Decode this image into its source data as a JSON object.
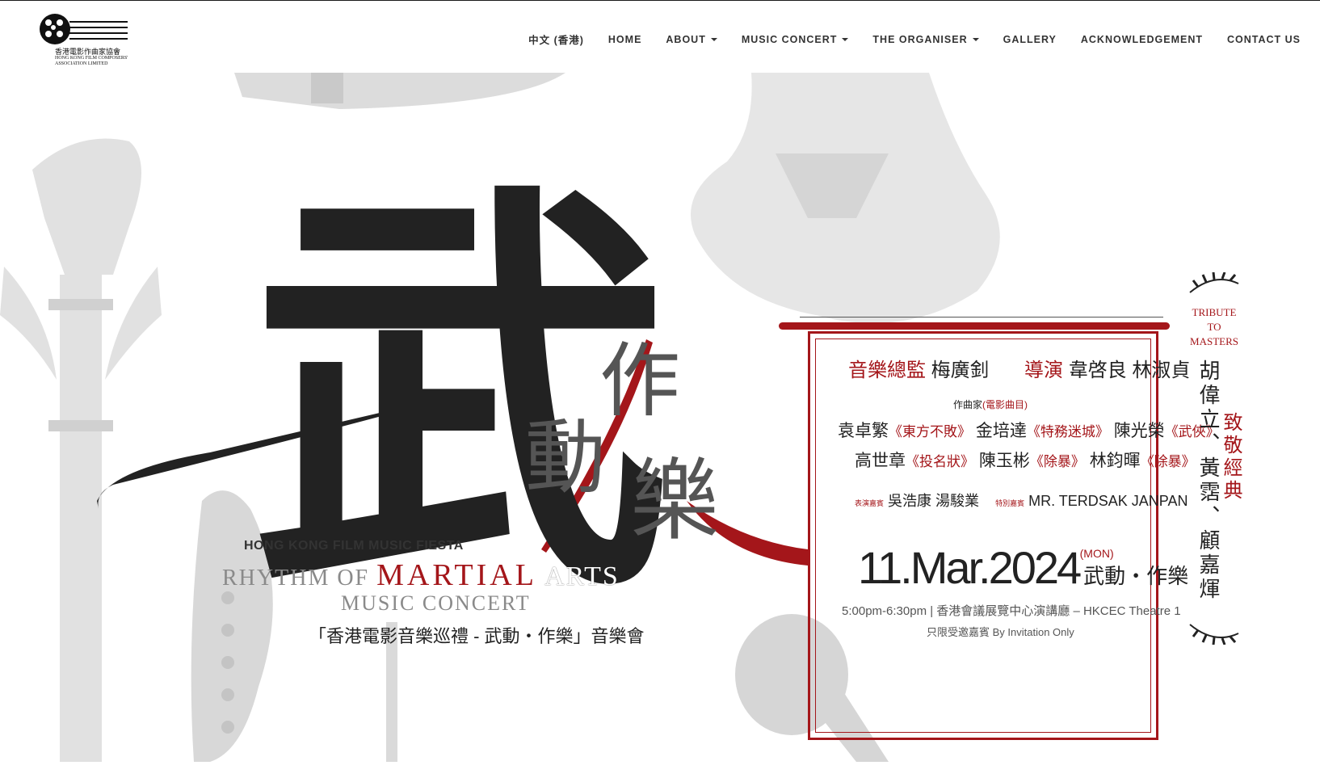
{
  "logo": {
    "cn": "香港電影作曲家協會",
    "en_line1": "HONG KONG FILM COMPOSERS'",
    "en_line2": "ASSOCIATION LIMITED"
  },
  "nav": {
    "items": [
      {
        "label": "中文 (香港)",
        "dropdown": false
      },
      {
        "label": "HOME",
        "dropdown": false
      },
      {
        "label": "ABOUT",
        "dropdown": true
      },
      {
        "label": "MUSIC CONCERT",
        "dropdown": true
      },
      {
        "label": "THE ORGANISER",
        "dropdown": true
      },
      {
        "label": "GALLERY",
        "dropdown": false
      },
      {
        "label": "ACKNOWLEDGEMENT",
        "dropdown": false
      },
      {
        "label": "CONTACT US",
        "dropdown": false
      }
    ]
  },
  "hero": {
    "calligraphy_main": "武",
    "calligraphy_dong": "動",
    "calligraphy_zuo": "作",
    "calligraphy_le": "樂",
    "fiesta": "HONG KONG FILM MUSIC FIESTA",
    "rhythm_of": "RHYTHM OF",
    "martial": "MARTIAL",
    "arts": "ARTS",
    "music_concert": "MUSIC CONCERT",
    "chinese_title": "「香港電影音樂巡禮 - 武動・作樂」音樂會"
  },
  "poster": {
    "music_director_label": "音樂總監",
    "music_director": "梅廣釗",
    "director_label": "導演",
    "directors": "韋啓良 林淑貞",
    "composers_label": "作曲家",
    "composers_sub": "(電影曲目)",
    "composer_row1": [
      {
        "name": "袁卓繁",
        "film": "《東方不敗》"
      },
      {
        "name": "金培達",
        "film": "《特務迷城》"
      },
      {
        "name": "陳光榮",
        "film": "《武俠》"
      }
    ],
    "composer_row2": [
      {
        "name": "高世章",
        "film": "《投名狀》"
      },
      {
        "name": "陳玉彬",
        "film": "《除暴》"
      },
      {
        "name": "林鈞暉",
        "film": "《除暴》"
      }
    ],
    "guest_label": "表演嘉賓",
    "guests": "吳浩康 湯駿業",
    "special_label": "特別嘉賓",
    "special_guest": "MR. TERDSAK JANPAN",
    "date": "11.Mar.2024",
    "weekday": "(MON)",
    "event_name": "武動・作樂",
    "time_venue": "5:00pm-6:30pm | 香港會議展覽中心演講廳 – HKCEC Theatre 1",
    "invitation": "只限受邀嘉賓 By Invitation Only"
  },
  "tribute": {
    "line1": "TRIBUTE",
    "line2": "TO",
    "line3": "MASTERS",
    "names": "胡偉立、黃霑、顧嘉煇",
    "salute": "致敬經典"
  },
  "colors": {
    "accent": "#a4161a",
    "ink": "#222222",
    "ghost": "#d9d9d9"
  }
}
